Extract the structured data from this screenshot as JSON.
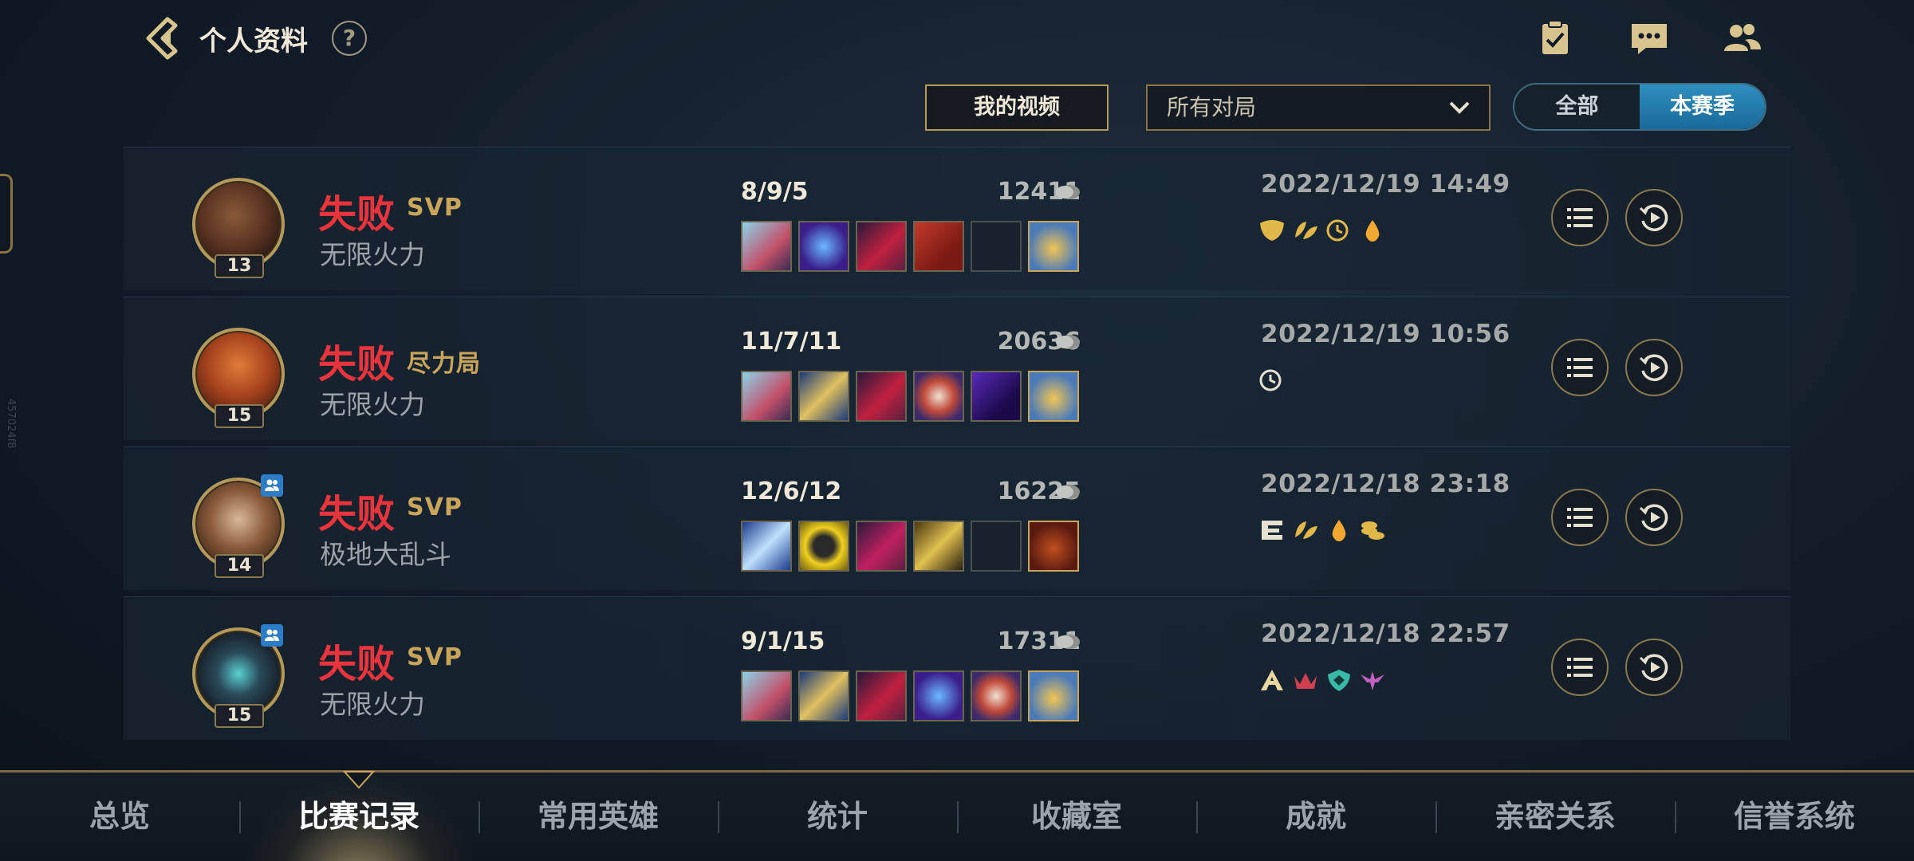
{
  "header": {
    "title": "个人资料",
    "help": "?"
  },
  "filters": {
    "video_label": "我的视频",
    "match_filter_value": "所有对局",
    "segment_all": "全部",
    "segment_season": "本赛季",
    "selected_segment": "本赛季"
  },
  "side_text": "457024f8",
  "matches": [
    {
      "result": "失败",
      "badge": "SVP",
      "mode": "无限火力",
      "level": "13",
      "kda": "8/9/5",
      "gold": "12411",
      "datetime": "2022/12/19 14:49",
      "party": false,
      "items": [
        "item",
        "item",
        "item",
        "item",
        "empty",
        "trinket"
      ],
      "tags": [
        "tag",
        "tag",
        "tag",
        "drop-tag"
      ]
    },
    {
      "result": "失败",
      "badge": "尽力局",
      "mode": "无限火力",
      "level": "15",
      "kda": "11/7/11",
      "gold": "20636",
      "datetime": "2022/12/19 10:56",
      "party": false,
      "items": [
        "item",
        "item",
        "item",
        "item",
        "item",
        "trinket"
      ],
      "tags": [
        "tag"
      ]
    },
    {
      "result": "失败",
      "badge": "SVP",
      "mode": "极地大乱斗",
      "level": "14",
      "kda": "12/6/12",
      "gold": "16225",
      "datetime": "2022/12/18 23:18",
      "party": true,
      "items": [
        "item",
        "item",
        "item",
        "item",
        "empty",
        "trinket"
      ],
      "tags": [
        "tag",
        "tag",
        "drop-tag",
        "tag"
      ]
    },
    {
      "result": "失败",
      "badge": "SVP",
      "mode": "无限火力",
      "level": "15",
      "kda": "9/1/15",
      "gold": "17311",
      "datetime": "2022/12/18 22:57",
      "party": true,
      "items": [
        "item",
        "item",
        "item",
        "item",
        "item",
        "trinket"
      ],
      "tags": [
        "letter-a-tag",
        "tag",
        "tag",
        "tag"
      ]
    }
  ],
  "nav": [
    "总览",
    "比赛记录",
    "常用英雄",
    "统计",
    "收藏室",
    "成就",
    "亲密关系",
    "信誉系统"
  ],
  "nav_active": "比赛记录",
  "colors": {
    "defeat": "#e8343c",
    "gold_accent": "#c8a55a",
    "segment_active": "#2f8fc0"
  }
}
